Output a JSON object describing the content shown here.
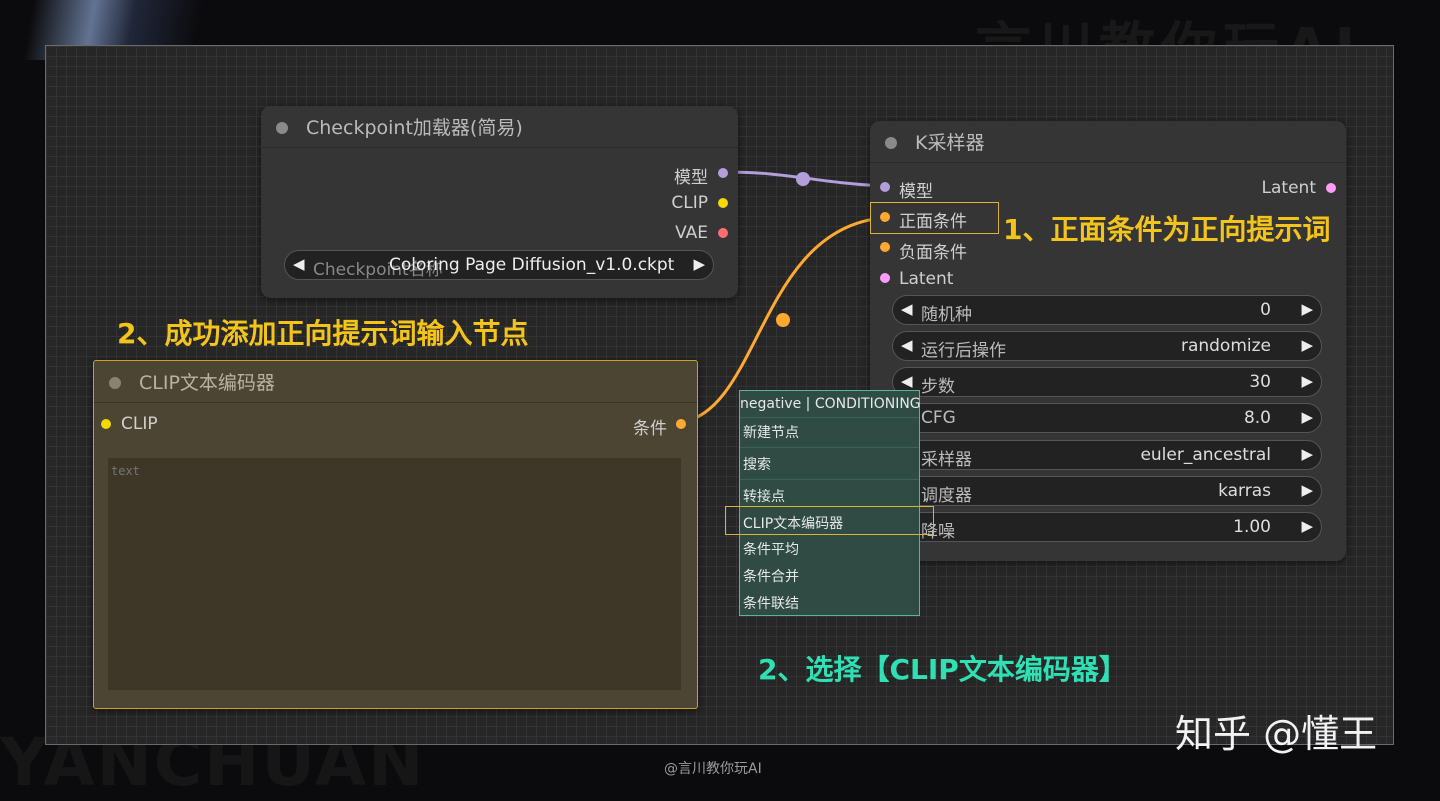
{
  "watermarks": {
    "top": "言川教你玩AI",
    "bottom": "YANCHUAN",
    "footer": "@言川教你玩AI",
    "corner": "知乎 @懂王"
  },
  "checkpoint_node": {
    "title": "Checkpoint加载器(简易)",
    "outputs": [
      "模型",
      "CLIP",
      "VAE"
    ],
    "widget_label": "Checkpoint名称",
    "widget_value": "Coloring Page Diffusion_v1.0.ckpt"
  },
  "ksampler_node": {
    "title": "K采样器",
    "inputs": [
      "模型",
      "正面条件",
      "负面条件",
      "Latent"
    ],
    "output": "Latent",
    "widgets": [
      {
        "label": "随机种",
        "value": "0"
      },
      {
        "label": "运行后操作",
        "value": "randomize"
      },
      {
        "label": "步数",
        "value": "30"
      },
      {
        "label": "CFG",
        "value": "8.0"
      },
      {
        "label": "采样器",
        "value": "euler_ancestral"
      },
      {
        "label": "调度器",
        "value": "karras"
      },
      {
        "label": "降噪",
        "value": "1.00"
      }
    ]
  },
  "clip_node": {
    "title": "CLIP文本编码器",
    "input": "CLIP",
    "output": "条件",
    "placeholder": "text"
  },
  "context_menu": {
    "header": "negative | CONDITIONING",
    "items": [
      "新建节点",
      "搜索",
      "转接点",
      "CLIP文本编码器",
      "条件平均",
      "条件合并",
      "条件联结"
    ]
  },
  "annotations": {
    "a1": "1、正面条件为正向提示词",
    "a2": "2、成功添加正向提示词输入节点",
    "a3": "2、选择【CLIP文本编码器】"
  },
  "colors": {
    "model": "#b39ddb",
    "clip": "#f5d800",
    "vae": "#ff6e6e",
    "conditioning": "#ffa931",
    "latent": "#ff9cf9",
    "annotation_yellow": "#f4c518",
    "annotation_teal": "#2fe0b5",
    "menu_bg": "#2f4b44"
  }
}
